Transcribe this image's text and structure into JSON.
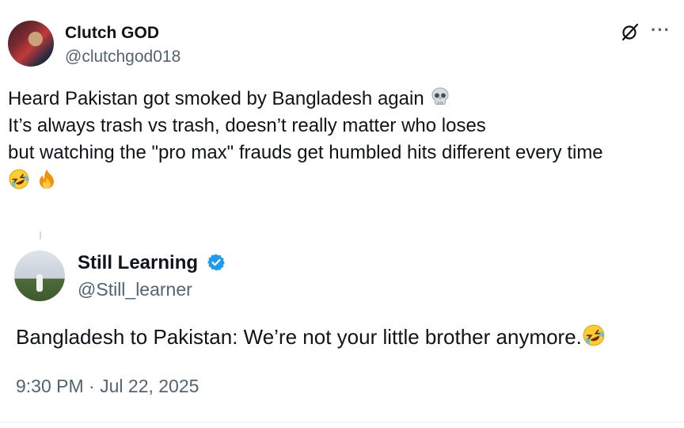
{
  "tweet": {
    "name": "Clutch GOD",
    "handle": "@clutchgod018",
    "lines": [
      "Heard Pakistan got smoked by Bangladesh again",
      "It’s always trash vs trash, doesn’t really matter who loses",
      "but watching the \"pro max\" frauds get humbled hits different every time"
    ],
    "more_icon": "···"
  },
  "quote": {
    "name": "Still Learning",
    "handle": "@Still_learner",
    "text": "Bangladesh to Pakistan: We’re not your little brother anymore."
  },
  "meta": {
    "time": "9:30 PM",
    "sep": " · ",
    "date": "Jul 22, 2025"
  },
  "colors": {
    "text": "#0f1419",
    "secondary": "#536471",
    "verified": "#1d9bf0"
  },
  "icons": [
    "skull-emoji",
    "rolling-laughing-emoji",
    "fire-emoji",
    "grok-icon",
    "more-icon",
    "verified-badge-icon"
  ]
}
